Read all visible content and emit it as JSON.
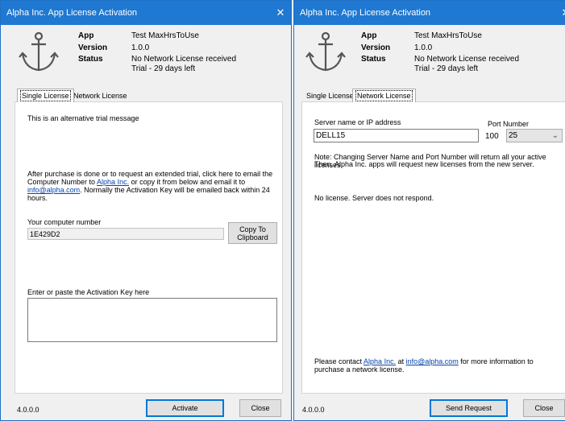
{
  "left": {
    "title": "Alpha Inc. App License Activation",
    "info": {
      "app_label": "App",
      "app_value": "Test MaxHrsToUse",
      "version_label": "Version",
      "version_value": "1.0.0",
      "status_label": "Status",
      "status_line1": "No Network License received",
      "status_line2": "Trial - 29 days left"
    },
    "tabs": [
      "Single License",
      "Network License"
    ],
    "active_tab": "Single License",
    "trial_message": "This is an alternative trial message",
    "instructions": {
      "line1": "After purchase is done or to request an extended trial, click here to email the",
      "line2_prefix": "Computer Number to ",
      "line2_link": "Alpha Inc.",
      "line2_suffix": " or copy it from below and email it to",
      "line3_link": "info@alpha.com",
      "line3_suffix": ". Normally the Activation Key will be emailed back within 24",
      "line4": "hours."
    },
    "computer_number_label": "Your computer number",
    "computer_number_value": "1E429D2",
    "copy_button_line1": "Copy To",
    "copy_button_line2": "Clipboard",
    "activation_key_label": "Enter or paste the Activation Key here",
    "activation_key_value": "",
    "footer_version": "4.0.0.0",
    "activate_button": "Activate",
    "close_button": "Close"
  },
  "right": {
    "title": "Alpha Inc. App License Activation",
    "info": {
      "app_label": "App",
      "app_value": "Test MaxHrsToUse",
      "version_label": "Version",
      "version_value": "1.0.0",
      "status_label": "Status",
      "status_line1": "No Network License received",
      "status_line2": "Trial - 29 days left"
    },
    "tabs": [
      "Single License",
      "Network License"
    ],
    "active_tab": "Network License",
    "server_label": "Server name or IP address",
    "server_value": "DELL15",
    "port_label": "Port Number",
    "port_value": "100",
    "port_select_value": "25",
    "note_line1": "Note: Changing Server Name and Port Number will return all your active licenses.",
    "note_line2": "Then, Alpha Inc. apps will request  new licenses from the new server.",
    "status_message": "No license. Server does not respond.",
    "contact": {
      "prefix": "Please contact ",
      "link1": "Alpha Inc.",
      "middle": " at ",
      "link2": "info@alpha.com",
      "suffix": " for more information to",
      "line2": "purchase a network license."
    },
    "footer_version": "4.0.0.0",
    "send_button": "Send Request",
    "close_button": "Close"
  }
}
